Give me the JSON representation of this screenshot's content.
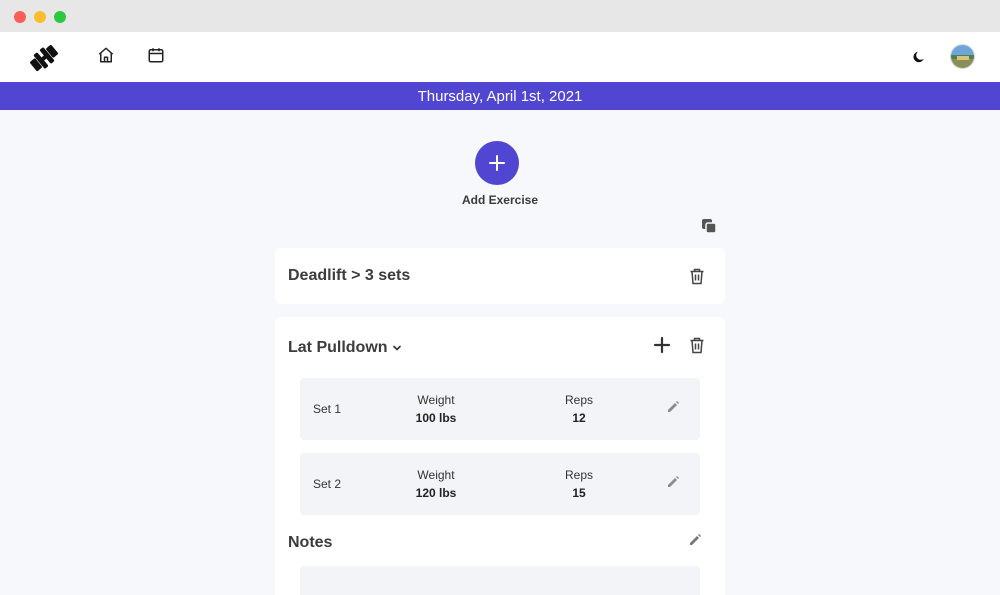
{
  "nav": {
    "logo_icon": "dumbbell-icon",
    "home_icon": "home-icon",
    "calendar_icon": "calendar-icon",
    "theme_icon": "moon-icon",
    "avatar_icon": "user-avatar"
  },
  "date_banner": "Thursday, April 1st, 2021",
  "add_exercise": {
    "label": "Add Exercise"
  },
  "colors": {
    "accent": "#5146d1",
    "background": "#f7f8fb",
    "card": "#ffffff",
    "set_row": "#f3f4f7"
  },
  "exercises": [
    {
      "title": "Deadlift > 3 sets",
      "collapsed": true
    },
    {
      "title": "Lat Pulldown",
      "collapsed": false,
      "sets": [
        {
          "name": "Set 1",
          "weight_label": "Weight",
          "weight": "100 lbs",
          "reps_label": "Reps",
          "reps": "12"
        },
        {
          "name": "Set 2",
          "weight_label": "Weight",
          "weight": "120 lbs",
          "reps_label": "Reps",
          "reps": "15"
        }
      ],
      "notes_title": "Notes"
    }
  ]
}
